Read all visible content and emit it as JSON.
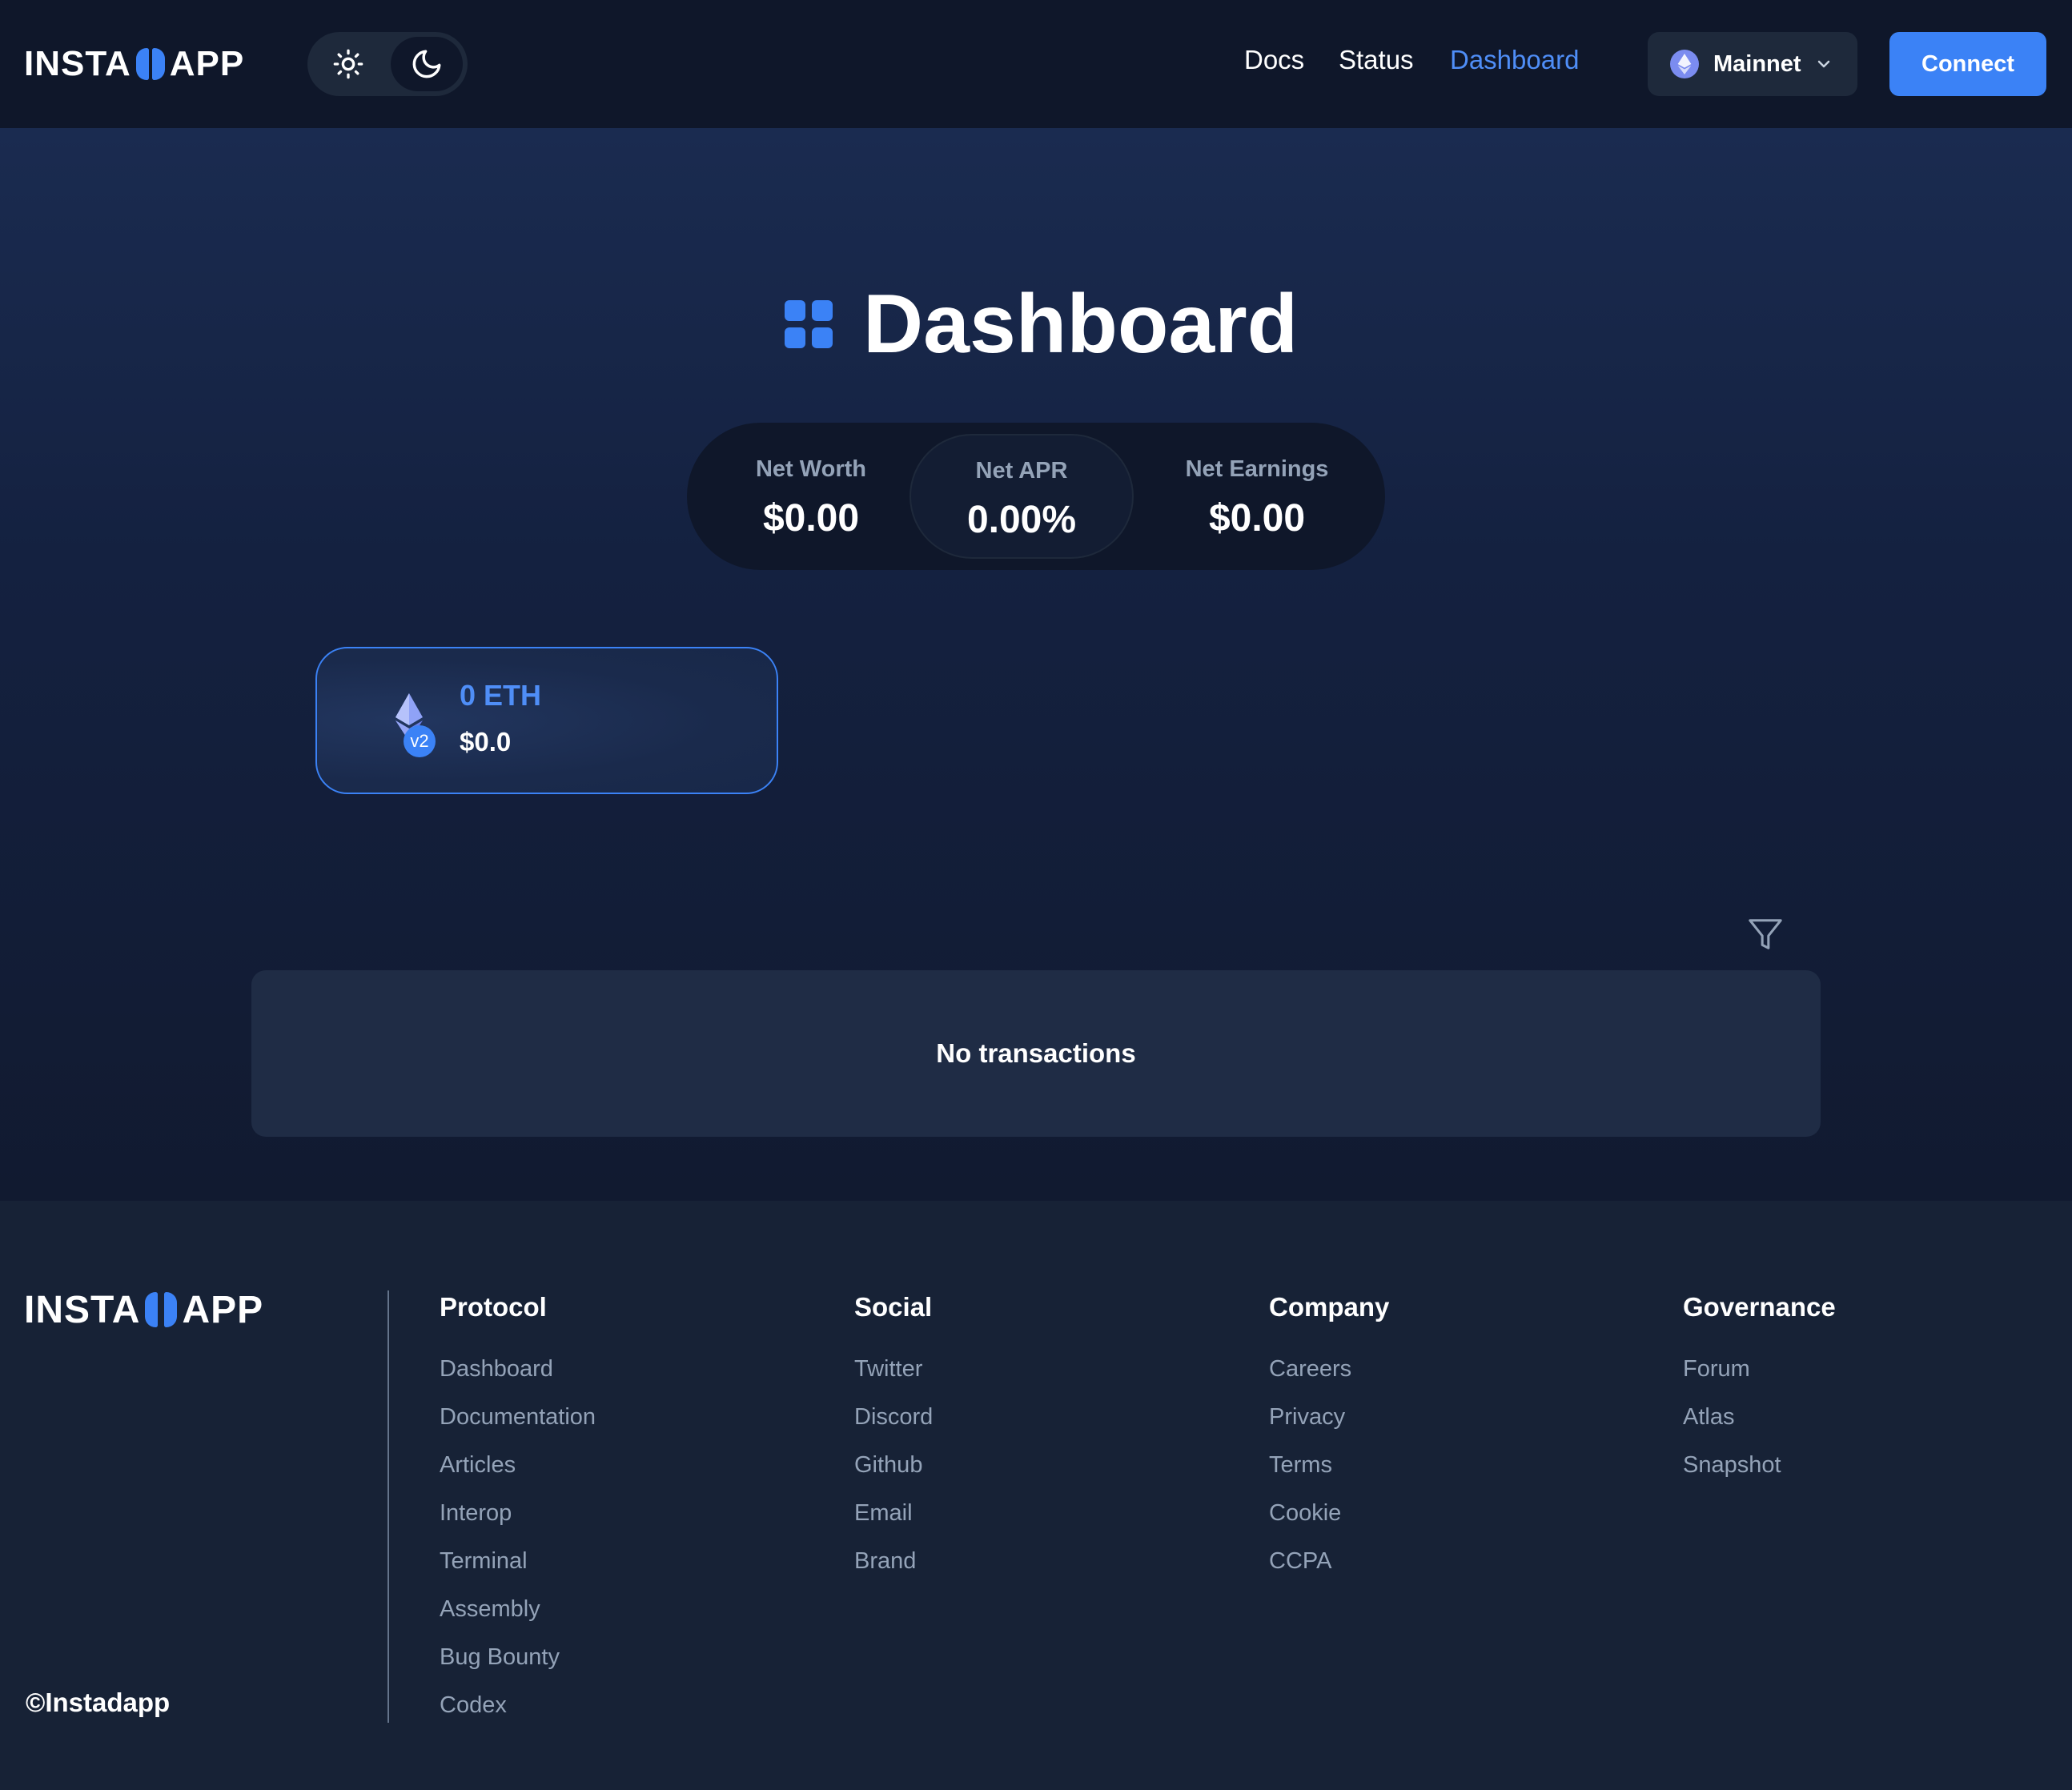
{
  "header": {
    "logo_left": "INSTA",
    "logo_right": "APP",
    "nav": [
      {
        "label": "Docs"
      },
      {
        "label": "Status"
      },
      {
        "label": "Dashboard"
      }
    ],
    "network": {
      "label": "Mainnet"
    },
    "connect_label": "Connect"
  },
  "main": {
    "title": "Dashboard",
    "stats": {
      "net_worth": {
        "label": "Net Worth",
        "value": "$0.00"
      },
      "net_apr": {
        "label": "Net APR",
        "value": "0.00%"
      },
      "net_earnings": {
        "label": "Net Earnings",
        "value": "$0.00"
      }
    },
    "eth_card": {
      "badge": "v2",
      "amount": "0 ETH",
      "usd": "$0.0"
    },
    "transactions_empty": "No transactions"
  },
  "footer": {
    "logo_left": "INSTA",
    "logo_right": "APP",
    "copyright": "©Instadapp",
    "columns": [
      {
        "title": "Protocol",
        "links": [
          "Dashboard",
          "Documentation",
          "Articles",
          "Interop",
          "Terminal",
          "Assembly",
          "Bug Bounty",
          "Codex"
        ]
      },
      {
        "title": "Social",
        "links": [
          "Twitter",
          "Discord",
          "Github",
          "Email",
          "Brand"
        ]
      },
      {
        "title": "Company",
        "links": [
          "Careers",
          "Privacy",
          "Terms",
          "Cookie",
          "CCPA"
        ]
      },
      {
        "title": "Governance",
        "links": [
          "Forum",
          "Atlas",
          "Snapshot"
        ]
      }
    ]
  },
  "colors": {
    "accent": "#3b82f6",
    "header_bg": "#0f172a",
    "footer_bg": "#172236",
    "muted_text": "#94a3b8"
  },
  "icons": [
    "sun-icon",
    "moon-icon",
    "ethereum-icon",
    "chevron-down-icon",
    "grid-icon",
    "filter-icon"
  ]
}
